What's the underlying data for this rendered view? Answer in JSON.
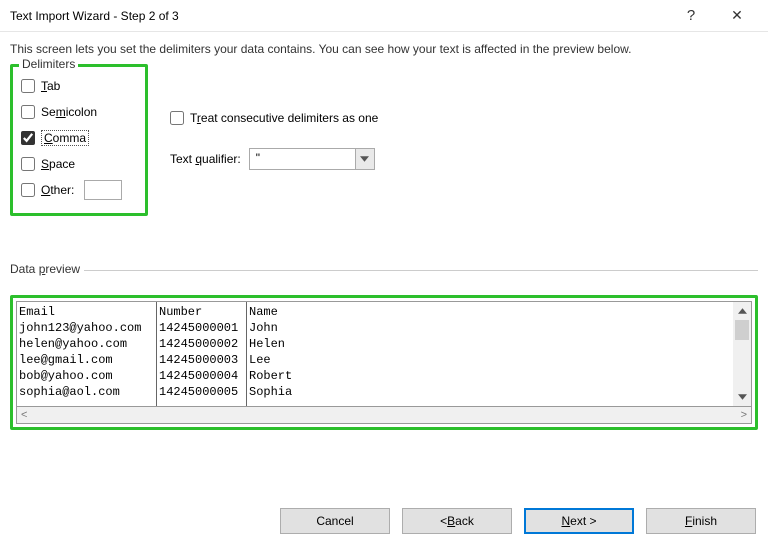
{
  "titlebar": {
    "title": "Text Import Wizard - Step 2 of 3",
    "help": "?",
    "close": "✕"
  },
  "description": "This screen lets you set the delimiters your data contains.  You can see how your text is affected in the preview below.",
  "delimiters": {
    "legend": "Delimiters",
    "tab": {
      "label": "Tab",
      "checked": false
    },
    "semicolon": {
      "label": "Semicolon",
      "checked": false
    },
    "comma": {
      "label": "Comma",
      "checked": true
    },
    "space": {
      "label": "Space",
      "checked": false
    },
    "other": {
      "label": "Other:",
      "checked": false,
      "value": ""
    }
  },
  "options": {
    "treat_consecutive": {
      "label": "Treat consecutive delimiters as one",
      "checked": false
    },
    "text_qualifier_label": "Text qualifier:",
    "text_qualifier_value": "\""
  },
  "preview": {
    "legend": "Data preview",
    "columns": [
      {
        "header": "Email",
        "rows": [
          "john123@yahoo.com",
          "helen@yahoo.com",
          "lee@gmail.com",
          "bob@yahoo.com",
          "sophia@aol.com"
        ]
      },
      {
        "header": "Number",
        "rows": [
          "14245000001",
          "14245000002",
          "14245000003",
          "14245000004",
          "14245000005"
        ]
      },
      {
        "header": "Name",
        "rows": [
          "John",
          "Helen",
          "Lee",
          "Robert",
          "Sophia"
        ]
      }
    ]
  },
  "buttons": {
    "cancel": "Cancel",
    "back": "< Back",
    "next": "Next >",
    "finish": "Finish"
  }
}
